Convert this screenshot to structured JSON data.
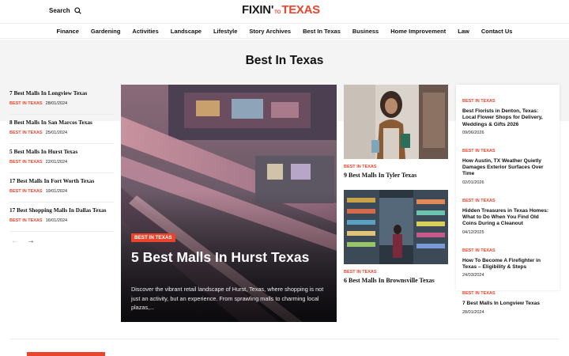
{
  "header": {
    "search_label": "Search",
    "logo_left": "FIXIN'",
    "logo_to": "TO",
    "logo_right": "TEXAS"
  },
  "nav": [
    "Finance",
    "Gardening",
    "Activities",
    "Landscape",
    "Lifestyle",
    "Story Archives",
    "Best In Texas",
    "Business",
    "Home Improvement",
    "Law",
    "Contact Us"
  ],
  "page_title": "Best In Texas",
  "list": [
    {
      "title": "7 Best Malls In Longview Texas",
      "category": "BEST IN TEXAS",
      "date": "28/01/2024"
    },
    {
      "title": "8 Best Malls In San Marcos Texas",
      "category": "BEST IN TEXAS",
      "date": "25/01/2024"
    },
    {
      "title": "5 Best Malls In Hurst Texas",
      "category": "BEST IN TEXAS",
      "date": "22/01/2024"
    },
    {
      "title": "17 Best Malls In Fort Worth Texas",
      "category": "BEST IN TEXAS",
      "date": "19/01/2024"
    },
    {
      "title": "17 Best Shopping Malls In Dallas Texas",
      "category": "BEST IN TEXAS",
      "date": "16/01/2024"
    }
  ],
  "feature": {
    "category": "BEST IN TEXAS",
    "title": "5 Best Malls In Hurst Texas",
    "description": "Discover the vibrant retail landscape of Hurst, Texas, where shopping is not just an activity, but an experience. From sprawling malls to charming local plazas,..."
  },
  "mid": [
    {
      "category": "BEST IN TEXAS",
      "title": "9 Best Malls In Tyler Texas"
    },
    {
      "category": "BEST IN TEXAS",
      "title": "6 Best Malls In Brownsville Texas"
    }
  ],
  "sidebar": [
    {
      "category": "BEST IN TEXAS",
      "title": "Best Florists in Denton, Texas: Local Flower Shops for Delivery, Weddings & Gifts 2026",
      "date": "09/06/2026"
    },
    {
      "category": "BEST IN TEXAS",
      "title": "How Austin, TX Weather Quietly Damages Exterior Surfaces Over Time",
      "date": "02/01/2026"
    },
    {
      "category": "BEST IN TEXAS",
      "title": "Hidden Treasures in Texas Homes: What to Do When You Find Old Coins During a Cleanout",
      "date": "04/12/2025"
    },
    {
      "category": "BEST IN TEXAS",
      "title": "How To Become A Firefighter in Texas – Eligibility & Steps",
      "date": "24/03/2024"
    },
    {
      "category": "BEST IN TEXAS",
      "title": "7 Best Malls In Longview Texas",
      "date": "28/01/2024"
    }
  ],
  "colors": {
    "accent": "#e8452c",
    "text": "#111111",
    "band": "#f4f4f4"
  },
  "icons": {
    "search": "search-icon",
    "prev": "arrow-left-icon",
    "next": "arrow-right-icon"
  }
}
